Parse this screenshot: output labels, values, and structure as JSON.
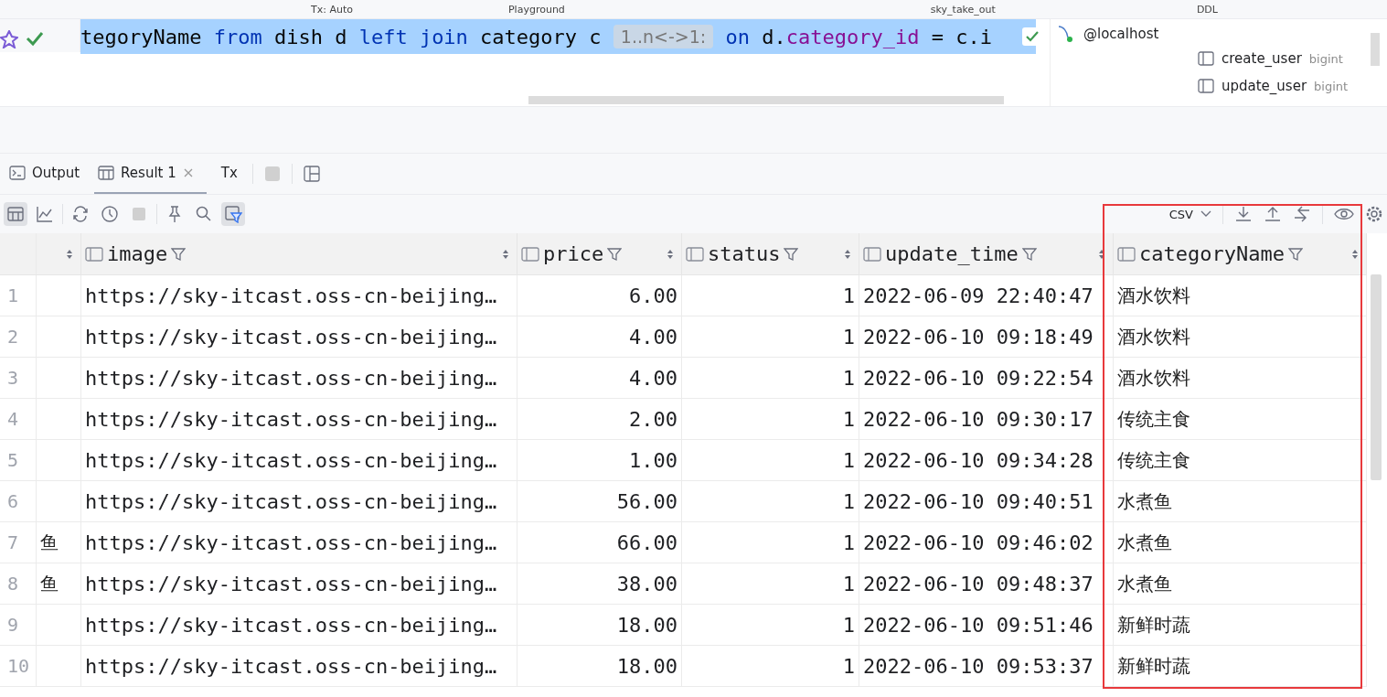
{
  "top_toolbar": {
    "items": [
      "Tx: Auto",
      "Playground",
      "sky_take_out",
      "DDL"
    ]
  },
  "editor": {
    "status_ok": true,
    "tokens": [
      {
        "text": "tegoryName ",
        "kind": "plain"
      },
      {
        "text": "from",
        "kind": "keyword"
      },
      {
        "text": " dish d ",
        "kind": "plain"
      },
      {
        "text": "left join",
        "kind": "keyword"
      },
      {
        "text": " category c ",
        "kind": "plain"
      },
      {
        "text": "1..n<->1:",
        "kind": "hint"
      },
      {
        "text": " on",
        "kind": "keyword"
      },
      {
        "text": " d.",
        "kind": "plain"
      },
      {
        "text": "category_id",
        "kind": "field"
      },
      {
        "text": " = c.i",
        "kind": "plain"
      }
    ]
  },
  "database_panel": {
    "host": "@localhost",
    "columns": [
      {
        "name": "create_user",
        "type": "bigint"
      },
      {
        "name": "update_user",
        "type": "bigint"
      }
    ]
  },
  "tabs": [
    {
      "label": "Output",
      "kind": "console",
      "selected": false
    },
    {
      "label": "Result 1",
      "kind": "table",
      "selected": true
    },
    {
      "label": "Tx",
      "kind": "tx",
      "selected": false
    }
  ],
  "result_toolbar": {
    "buttons": [
      {
        "kind": "grid",
        "selected": true
      },
      {
        "kind": "chart",
        "selected": false
      },
      {
        "kind": "refresh",
        "selected": false
      },
      {
        "kind": "history",
        "selected": false
      },
      {
        "kind": "stop",
        "selected": false
      },
      {
        "kind": "pin",
        "selected": false
      },
      {
        "kind": "search",
        "selected": false
      },
      {
        "kind": "filter",
        "selected": true
      }
    ],
    "export_format": "CSV"
  },
  "table": {
    "columns": [
      "image",
      "price",
      "status",
      "update_time",
      "categoryName"
    ],
    "rows": [
      {
        "num": "1",
        "image": "https://sky-itcast.oss-cn-beijing…",
        "price": "6.00",
        "status": "1",
        "update_time": "2022-06-09 22:40:47",
        "categoryName": "酒水饮料"
      },
      {
        "num": "2",
        "image": "https://sky-itcast.oss-cn-beijing…",
        "price": "4.00",
        "status": "1",
        "update_time": "2022-06-10 09:18:49",
        "categoryName": "酒水饮料"
      },
      {
        "num": "3",
        "image": "https://sky-itcast.oss-cn-beijing…",
        "price": "4.00",
        "status": "1",
        "update_time": "2022-06-10 09:22:54",
        "categoryName": "酒水饮料"
      },
      {
        "num": "4",
        "image": "https://sky-itcast.oss-cn-beijing…",
        "price": "2.00",
        "status": "1",
        "update_time": "2022-06-10 09:30:17",
        "categoryName": "传统主食"
      },
      {
        "num": "5",
        "image": "https://sky-itcast.oss-cn-beijing…",
        "price": "1.00",
        "status": "1",
        "update_time": "2022-06-10 09:34:28",
        "categoryName": "传统主食"
      },
      {
        "num": "6",
        "image": "https://sky-itcast.oss-cn-beijing…",
        "price": "56.00",
        "status": "1",
        "update_time": "2022-06-10 09:40:51",
        "categoryName": "水煮鱼"
      },
      {
        "num": "7",
        "column_1": "鱼",
        "image": "https://sky-itcast.oss-cn-beijing…",
        "price": "66.00",
        "status": "1",
        "update_time": "2022-06-10 09:46:02",
        "categoryName": "水煮鱼"
      },
      {
        "num": "8",
        "column_1": "鱼",
        "image": "https://sky-itcast.oss-cn-beijing…",
        "price": "38.00",
        "status": "1",
        "update_time": "2022-06-10 09:48:37",
        "categoryName": "水煮鱼"
      },
      {
        "num": "9",
        "image": "https://sky-itcast.oss-cn-beijing…",
        "price": "18.00",
        "status": "1",
        "update_time": "2022-06-10 09:51:46",
        "categoryName": "新鲜时蔬"
      },
      {
        "num": "10",
        "image": "https://sky-itcast.oss-cn-beijing…",
        "price": "18.00",
        "status": "1",
        "update_time": "2022-06-10 09:53:37",
        "categoryName": "新鲜时蔬"
      }
    ]
  }
}
